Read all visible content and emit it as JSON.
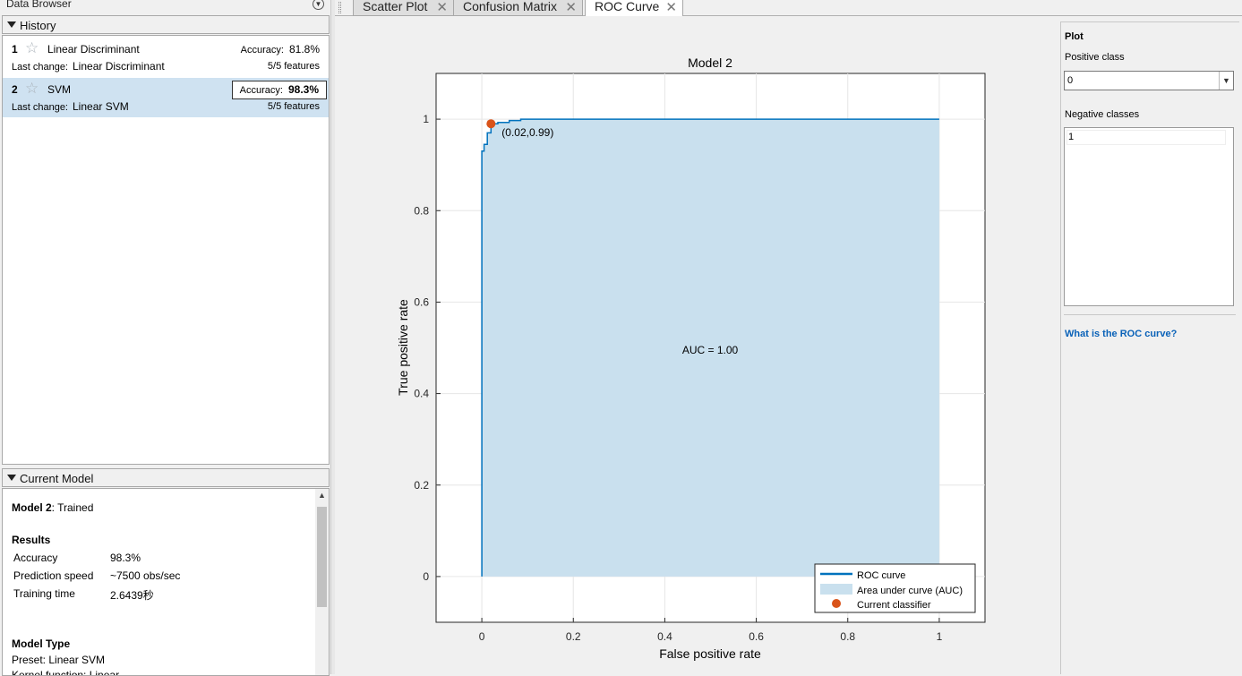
{
  "data_browser": {
    "title": "Data Browser"
  },
  "history": {
    "title": "History",
    "models": [
      {
        "number": "1",
        "name": "Linear Discriminant",
        "accuracy_label": "Accuracy:",
        "accuracy": "81.8%",
        "last_change_label": "Last change:",
        "last_change": "Linear Discriminant",
        "features": "5/5 features"
      },
      {
        "number": "2",
        "name": "SVM",
        "accuracy_label": "Accuracy:",
        "accuracy": "98.3%",
        "last_change_label": "Last change:",
        "last_change": "Linear SVM",
        "features": "5/5 features"
      }
    ]
  },
  "current_model": {
    "title": "Current Model",
    "model_name": "Model 2",
    "status": ": Trained",
    "results_heading": "Results",
    "results": [
      {
        "label": "Accuracy",
        "value": "98.3%"
      },
      {
        "label": "Prediction speed",
        "value": "~7500 obs/sec"
      },
      {
        "label": "Training time",
        "value": "2.6439秒"
      }
    ],
    "model_type_heading": "Model Type",
    "preset": "Preset: Linear SVM",
    "kernel": "Kernel function: Linear"
  },
  "tabs": [
    {
      "label": "Scatter Plot",
      "close": "✕"
    },
    {
      "label": "Confusion Matrix",
      "close": "✕"
    },
    {
      "label": "ROC Curve",
      "close": "✕"
    }
  ],
  "chart_data": {
    "type": "line",
    "title": "Model 2",
    "xlabel": "False positive rate",
    "ylabel": "True positive rate",
    "xlim": [
      -0.1,
      1.1
    ],
    "ylim": [
      -0.1,
      1.1
    ],
    "xticks": [
      "0",
      "0.2",
      "0.4",
      "0.6",
      "0.8",
      "1"
    ],
    "yticks": [
      "0",
      "0.2",
      "0.4",
      "0.6",
      "0.8",
      "1"
    ],
    "grid": true,
    "series": [
      {
        "name": "ROC curve",
        "color": "#0072bd",
        "x": [
          0,
          0,
          0.005,
          0.005,
          0.012,
          0.012,
          0.02,
          0.02,
          0.035,
          0.035,
          0.06,
          0.06,
          0.085,
          0.085,
          1
        ],
        "y": [
          0,
          0.93,
          0.93,
          0.945,
          0.945,
          0.97,
          0.97,
          0.99,
          0.99,
          0.993,
          0.993,
          0.997,
          0.997,
          1,
          1
        ]
      }
    ],
    "area_label": "Area under curve (AUC)",
    "area_color": "#c9e0ee",
    "auc_text": "AUC = 1.00",
    "current_classifier": {
      "name": "Current classifier",
      "x": 0.02,
      "y": 0.99,
      "label": "(0.02,0.99)",
      "color": "#d95319"
    },
    "legend": "bottom-right"
  },
  "plot_panel": {
    "title": "Plot",
    "positive_class_label": "Positive class",
    "positive_class_value": "0",
    "negative_classes_label": "Negative classes",
    "negative_classes": [
      "1"
    ],
    "help_link": "What is the ROC curve?"
  }
}
